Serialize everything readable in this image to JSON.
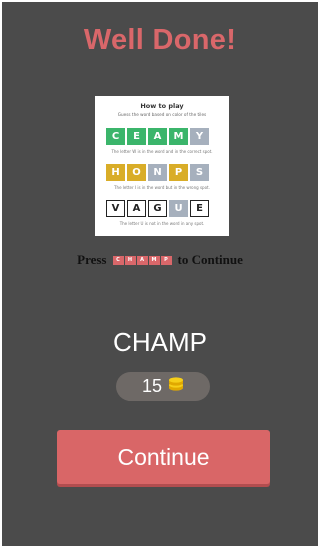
{
  "title": "Well Done!",
  "instructions": {
    "heading": "How to play",
    "subheading": "Guess the word based on color of the tiles",
    "examples": [
      {
        "tiles": [
          {
            "letter": "C",
            "state": "green"
          },
          {
            "letter": "E",
            "state": "green"
          },
          {
            "letter": "A",
            "state": "green"
          },
          {
            "letter": "M",
            "state": "green"
          },
          {
            "letter": "Y",
            "state": "gray"
          }
        ],
        "hint": "The letter W is in the word and in the correct spot."
      },
      {
        "tiles": [
          {
            "letter": "H",
            "state": "yellow"
          },
          {
            "letter": "O",
            "state": "yellow"
          },
          {
            "letter": "N",
            "state": "gray"
          },
          {
            "letter": "P",
            "state": "yellow"
          },
          {
            "letter": "S",
            "state": "gray"
          }
        ],
        "hint": "The letter I is in the word but in the wrong spot."
      },
      {
        "tiles": [
          {
            "letter": "V",
            "state": "blank"
          },
          {
            "letter": "A",
            "state": "blank"
          },
          {
            "letter": "G",
            "state": "blank"
          },
          {
            "letter": "U",
            "state": "wrong"
          },
          {
            "letter": "E",
            "state": "blank"
          }
        ],
        "hint": "The letter U is not in the word in any spot."
      }
    ]
  },
  "press_prompt": {
    "before": "Press",
    "key_letters": [
      "C",
      "H",
      "A",
      "M",
      "P"
    ],
    "after": "to Continue"
  },
  "answer_word": "CHAMP",
  "coins": {
    "count": "15",
    "icon": "coin-stack-icon",
    "color": "#f2c811"
  },
  "continue_label": "Continue",
  "colors": {
    "accent": "#d9676a",
    "background": "#4b4b4b",
    "green": "#3bb56b",
    "yellow": "#d9ad28",
    "gray": "#a6b0bd"
  }
}
